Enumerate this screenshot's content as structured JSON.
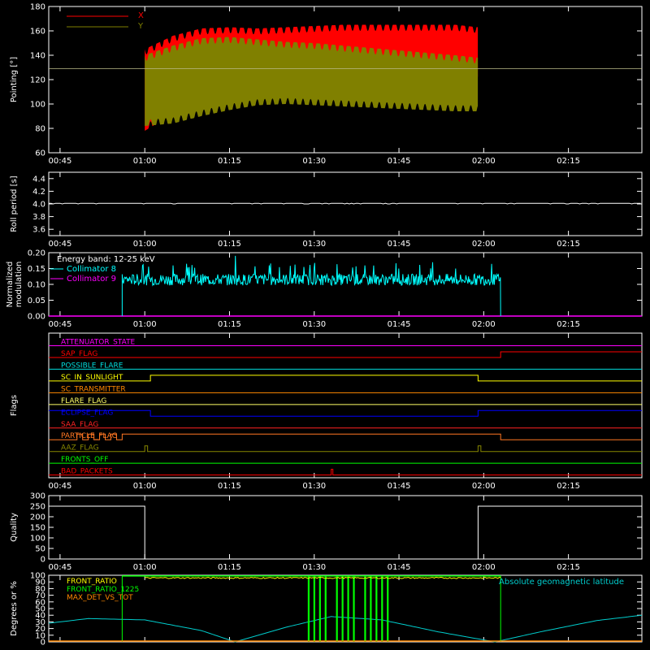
{
  "colors": {
    "background": "#000000",
    "axes": "#ffffff",
    "x_pointing": "#ff0000",
    "y_pointing": "#808000",
    "collimator8": "#00ffff",
    "collimator9": "#ff00ff",
    "geomag": "#00cccc",
    "front_ratio": "#ffff00",
    "front_ratio_1225": "#00ff00",
    "max_det": "#ff8800"
  },
  "time_axis": {
    "xlim": [
      "00:43",
      "02:28"
    ],
    "ticks": [
      "00:45",
      "01:00",
      "01:15",
      "01:30",
      "01:45",
      "02:00",
      "02:15"
    ]
  },
  "chart_data": [
    {
      "type": "area",
      "ylabel": "Pointing [°]",
      "ylim": [
        60,
        180
      ],
      "yticks": [
        "60",
        "80",
        "100",
        "120",
        "140",
        "160",
        "180"
      ],
      "legend": {
        "placement": "top-left",
        "entries": [
          "X",
          "Y"
        ]
      },
      "reference_line": 129,
      "series": [
        {
          "name": "X",
          "x": [
            "01:00",
            "01:05",
            "01:10",
            "01:15",
            "01:20",
            "01:25",
            "01:30",
            "01:35",
            "01:40",
            "01:45",
            "01:50",
            "01:55",
            "01:59"
          ],
          "upper": [
            145,
            156,
            162,
            163,
            162,
            163,
            164,
            165,
            165,
            165,
            165,
            165,
            163
          ],
          "lower": [
            78,
            92,
            102,
            108,
            112,
            114,
            115,
            116,
            117,
            117,
            118,
            118,
            118
          ]
        },
        {
          "name": "Y",
          "x": [
            "01:00",
            "01:05",
            "01:10",
            "01:15",
            "01:20",
            "01:25",
            "01:30",
            "01:35",
            "01:40",
            "01:45",
            "01:50",
            "01:55",
            "01:59"
          ],
          "upper": [
            140,
            148,
            154,
            155,
            153,
            151,
            150,
            148,
            146,
            144,
            142,
            140,
            138
          ],
          "lower": [
            82,
            84,
            90,
            95,
            99,
            100,
            99,
            98,
            97,
            96,
            95,
            94,
            94
          ]
        }
      ]
    },
    {
      "type": "line",
      "ylabel": "Roll period [s]",
      "ylim": [
        3.5,
        4.5
      ],
      "yticks": [
        "3.6",
        "3.8",
        "4.0",
        "4.2",
        "4.4"
      ],
      "series": [
        {
          "x": [
            "00:43",
            "02:28"
          ],
          "values": [
            4.01,
            4.01
          ]
        }
      ]
    },
    {
      "type": "line",
      "ylabel": "Normalized\nmodulation",
      "ylabel_lines": [
        "Normalized",
        "modulation"
      ],
      "ylim": [
        0,
        0.2
      ],
      "yticks": [
        "0.00",
        "0.05",
        "0.10",
        "0.15",
        "0.20"
      ],
      "annotation": "Energy band: 12-25 keV",
      "legend": {
        "placement": "top-left",
        "entries": [
          "Collimator 8",
          "Collimator 9"
        ]
      },
      "series": [
        {
          "name": "Collimator 8",
          "x_start": "00:56",
          "x_end": "02:03",
          "baseline": 0.115,
          "noise": 0.018,
          "spikes": [
            [
              "01:05",
              0.16
            ],
            [
              "01:16",
              0.19
            ],
            [
              "01:22",
              0.16
            ],
            [
              "01:30",
              0.15
            ],
            [
              "01:39",
              0.16
            ],
            [
              "01:45",
              0.15
            ],
            [
              "01:55",
              0.15
            ]
          ]
        },
        {
          "name": "Collimator 9",
          "x": [
            "00:43",
            "02:28"
          ],
          "values": [
            0,
            0
          ]
        }
      ]
    },
    {
      "type": "table",
      "ylabel": "Flags",
      "flags": [
        {
          "name": "ATTENUATOR_STATE",
          "color": "#ff00ff",
          "highs": []
        },
        {
          "name": "SAP_FLAG",
          "color": "#ff0000",
          "highs": [
            [
              "02:03",
              "02:28"
            ]
          ]
        },
        {
          "name": "POSSIBLE_FLARE",
          "color": "#00dddd",
          "highs": []
        },
        {
          "name": "SC_IN_SUNLIGHT",
          "color": "#ffff00",
          "highs": [
            [
              "01:01",
              "01:59"
            ]
          ]
        },
        {
          "name": "SC_TRANSMITTER",
          "color": "#ff8800",
          "highs": []
        },
        {
          "name": "FLARE_FLAG",
          "color": "#ffff66",
          "highs": []
        },
        {
          "name": "ECLIPSE_FLAG",
          "color": "#0000ff",
          "highs": [
            [
              "00:43",
              "01:01"
            ],
            [
              "01:59",
              "02:28"
            ]
          ]
        },
        {
          "name": "SAA_FLAG",
          "color": "#ff2222",
          "highs": []
        },
        {
          "name": "PARTICLE_FLAG",
          "color": "#ff7722",
          "highs": [
            [
              "00:48",
              "00:49"
            ],
            [
              "00:50",
              "00:51"
            ],
            [
              "00:52",
              "00:53"
            ],
            [
              "00:54",
              "00:55"
            ],
            [
              "00:56",
              "02:03"
            ]
          ]
        },
        {
          "name": "AAZ_FLAG",
          "color": "#888800",
          "highs": [
            [
              "01:00",
              "01:00.5"
            ],
            [
              "01:59",
              "01:59.5"
            ]
          ]
        },
        {
          "name": "FRONTS_OFF",
          "color": "#00ff00",
          "highs": []
        },
        {
          "name": "BAD_PACKETS",
          "color": "#ff0000",
          "highs": [
            [
              "01:33",
              "01:33.3"
            ]
          ]
        }
      ]
    },
    {
      "type": "line",
      "ylabel": "Quality",
      "ylim": [
        0,
        300
      ],
      "yticks": [
        "0",
        "50",
        "100",
        "150",
        "200",
        "250",
        "300"
      ],
      "series": [
        {
          "x": [
            "00:43",
            "01:00",
            "01:00",
            "01:59",
            "01:59",
            "02:28"
          ],
          "values": [
            250,
            250,
            0,
            0,
            250,
            250
          ]
        }
      ]
    },
    {
      "type": "line",
      "ylabel": "Degrees or %",
      "ylim": [
        0,
        100
      ],
      "yticks": [
        "0",
        "10",
        "20",
        "30",
        "40",
        "50",
        "60",
        "70",
        "80",
        "90",
        "100"
      ],
      "legend": {
        "placement": "top-left",
        "entries": [
          "FRONT_RATIO",
          "FRONT_RATIO_1225",
          "MAX_DET_VS_TOT"
        ]
      },
      "annotation": "Absolute geomagnetic latitude",
      "series": [
        {
          "name": "Absolute geomagnetic latitude",
          "x": [
            "00:43",
            "00:50",
            "01:00",
            "01:10",
            "01:16",
            "01:25",
            "01:33",
            "01:42",
            "01:52",
            "02:02",
            "02:10",
            "02:20",
            "02:28"
          ],
          "values": [
            28,
            35,
            33,
            17,
            0,
            22,
            38,
            33,
            15,
            0,
            15,
            32,
            40
          ]
        },
        {
          "name": "FRONT_RATIO",
          "x_start": "01:00",
          "x_end": "02:03",
          "value": 96
        },
        {
          "name": "FRONT_RATIO_1225",
          "x_start": "00:56",
          "x_end": "02:03",
          "value": 99,
          "dropouts": [
            "01:29",
            "01:30",
            "01:31",
            "01:32",
            "01:34",
            "01:35",
            "01:36",
            "01:37",
            "01:39",
            "01:40",
            "01:41",
            "01:42",
            "01:43"
          ]
        },
        {
          "name": "MAX_DET_VS_TOT",
          "x": [
            "00:43",
            "02:28"
          ],
          "values": [
            0,
            0
          ]
        }
      ]
    }
  ]
}
